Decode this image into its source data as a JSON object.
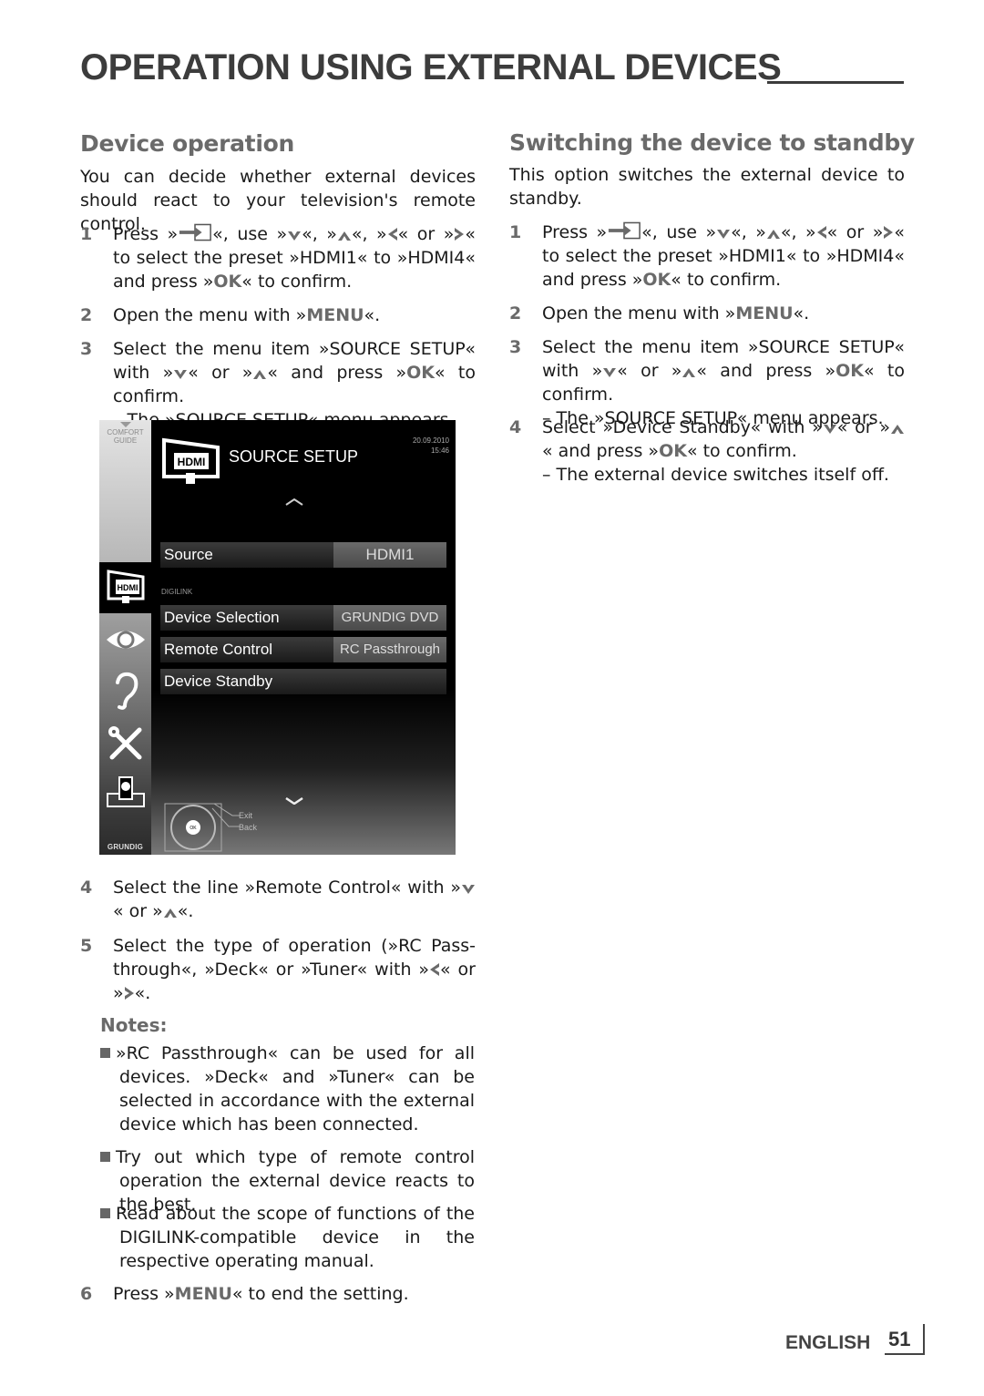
{
  "page": {
    "title": "OPERATION USING EXTERNAL DEVICES",
    "language": "ENGLISH",
    "page_number": "51"
  },
  "left": {
    "heading": "Device operation",
    "intro": "You can decide whether external devices should react to your television's remote control.",
    "steps": [
      {
        "num": "1",
        "parts": [
          "Press »",
          "«, use »",
          "«, »",
          "«, »",
          "« or »",
          "« to select the preset »HDMI1« to »HDMI4« and press »",
          "OK",
          "« to confirm."
        ]
      },
      {
        "num": "2",
        "pre": "Open the menu with »",
        "key": "MENU",
        "post": "«."
      },
      {
        "num": "3",
        "pre": "Select the menu item »SOURCE SETUP« with »",
        "mid": "« or »",
        "mid2": "« and press »",
        "key": "OK",
        "post": "« to confirm.",
        "result": "– The »SOURCE SETUP« menu appears."
      },
      {
        "num": "4",
        "pre": "Select the line »Remote Control« with »",
        "mid": "« or »",
        "post": "«."
      },
      {
        "num": "5",
        "pre": "Select the type of operation (»RC Pass-through«, »Deck« or »Tuner« with »",
        "mid": "« or »",
        "post": "«."
      },
      {
        "num": "6",
        "pre": "Press »",
        "key": "MENU",
        "post": "« to end the setting."
      }
    ],
    "notes_heading": "Notes:",
    "notes": [
      "»RC Passthrough« can be used for all devices. »Deck« and »Tuner« can be selected in accordance with the external device which has been connected.",
      "Try out which type of remote control operation the external device reacts to the best.",
      "Read about the scope of functions of the DIGILINK-compatible device in the respective operating manual."
    ]
  },
  "tv_menu": {
    "sidebar_label_1": "COMFORT",
    "sidebar_label_2": "GUIDE",
    "brand": "GRUNDIG",
    "icon_label": "HDMI",
    "title": "SOURCE SETUP",
    "date": "20.09.2010",
    "time": "15:46",
    "section_label": "DIGILINK",
    "rows": [
      {
        "label": "Source",
        "value": "HDMI1"
      },
      {
        "label": "Device Selection",
        "value": "GRUNDIG DVD"
      },
      {
        "label": "Remote Control",
        "value": "RC Passthrough"
      },
      {
        "label": "Device Standby",
        "value": ""
      }
    ],
    "nav_exit": "Exit",
    "nav_back": "Back",
    "ok_label": "OK"
  },
  "right": {
    "heading": "Switching the device to standby",
    "intro": "This option switches the external device to standby.",
    "steps": [
      {
        "num": "1"
      },
      {
        "num": "2",
        "pre": "Open the menu with »",
        "key": "MENU",
        "post": "«."
      },
      {
        "num": "3",
        "pre": "Select the menu item »SOURCE SETUP« with »",
        "mid": "« or »",
        "mid2": "« and press »",
        "key": "OK",
        "post": "« to confirm.",
        "result": "– The »SOURCE SETUP« menu appears."
      },
      {
        "num": "4",
        "pre": "Select »Device Standby« with »",
        "mid": "« or »",
        "mid2": "« and press »",
        "key": "OK",
        "post": "« to confirm.",
        "result": "– The external device switches itself off."
      }
    ]
  }
}
